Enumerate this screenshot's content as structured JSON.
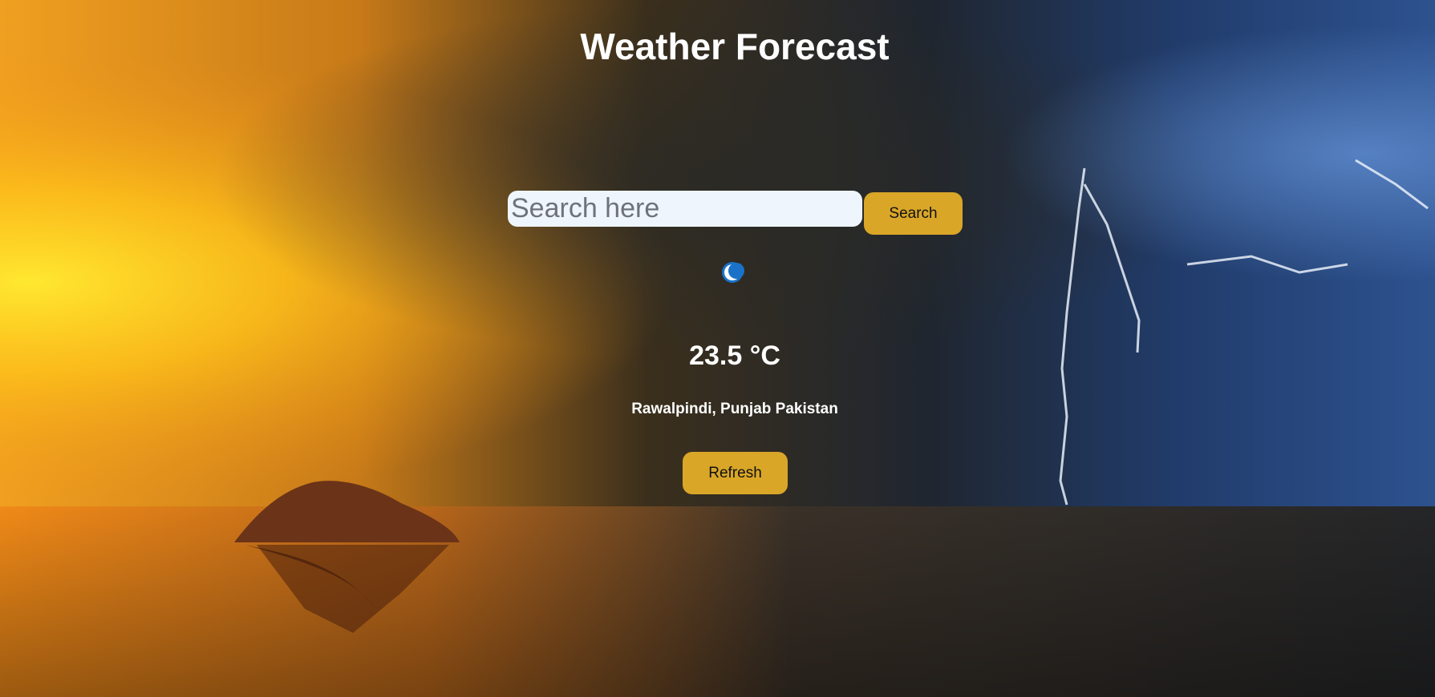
{
  "header": {
    "title": "Weather Forecast"
  },
  "search": {
    "placeholder": "Search here",
    "value": "",
    "button_label": "Search"
  },
  "weather": {
    "icon": "crescent-moon-icon",
    "temperature": "23.5 °C",
    "location": "Rawalpindi, Punjab Pakistan"
  },
  "actions": {
    "refresh_label": "Refresh"
  },
  "colors": {
    "button_bg": "#d9a628",
    "input_bg": "#eef5fc",
    "text": "#ffffff",
    "moon": "#1a73c8"
  }
}
